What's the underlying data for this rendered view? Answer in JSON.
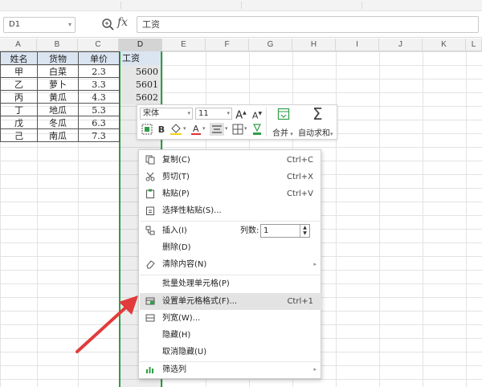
{
  "formula_bar": {
    "name_box": "D1",
    "fx": "fx",
    "formula_value": "工资"
  },
  "columns": [
    "A",
    "B",
    "C",
    "D",
    "E",
    "F",
    "G",
    "H",
    "I",
    "J",
    "K",
    "L"
  ],
  "table": {
    "headers": [
      "姓名",
      "货物",
      "单价",
      "工资"
    ],
    "rows": [
      [
        "甲",
        "白菜",
        "2.3",
        "5600"
      ],
      [
        "乙",
        "萝卜",
        "3.3",
        "5601"
      ],
      [
        "丙",
        "黄瓜",
        "4.3",
        "5602"
      ],
      [
        "丁",
        "地瓜",
        "5.3",
        ""
      ],
      [
        "戊",
        "冬瓜",
        "6.3",
        ""
      ],
      [
        "己",
        "南瓜",
        "7.3",
        ""
      ]
    ]
  },
  "mini_toolbar": {
    "font": "宋体",
    "size": "11",
    "grow_font": "A",
    "shrink_font": "A",
    "bold": "B",
    "merge_label": "合并",
    "autosum_label": "自动求和"
  },
  "context_menu": {
    "items": [
      {
        "label": "复制(C)",
        "shortcut": "Ctrl+C",
        "icon": "copy-icon"
      },
      {
        "label": "剪切(T)",
        "shortcut": "Ctrl+X",
        "icon": "scissors-icon"
      },
      {
        "label": "粘贴(P)",
        "shortcut": "Ctrl+V",
        "icon": "paste-icon"
      },
      {
        "label": "选择性粘贴(S)...",
        "shortcut": "",
        "icon": "paste-special-icon"
      },
      {
        "label": "插入(I)",
        "shortcut": "",
        "icon": "insert-icon"
      },
      {
        "label": "删除(D)",
        "shortcut": "",
        "icon": ""
      },
      {
        "label": "清除内容(N)",
        "shortcut": "",
        "icon": "eraser-icon"
      },
      {
        "label": "批量处理单元格(P)",
        "shortcut": "",
        "icon": ""
      },
      {
        "label": "设置单元格格式(F)...",
        "shortcut": "Ctrl+1",
        "icon": "format-cells-icon"
      },
      {
        "label": "列宽(W)...",
        "shortcut": "",
        "icon": "column-width-icon"
      },
      {
        "label": "隐藏(H)",
        "shortcut": "",
        "icon": ""
      },
      {
        "label": "取消隐藏(U)",
        "shortcut": "",
        "icon": ""
      },
      {
        "label": "筛选列",
        "shortcut": "",
        "icon": "filter-column-icon"
      }
    ],
    "columns_label": "列数:",
    "columns_value": "1",
    "highlighted": "设置单元格格式(F)...",
    "accent": "#2e9e47"
  }
}
